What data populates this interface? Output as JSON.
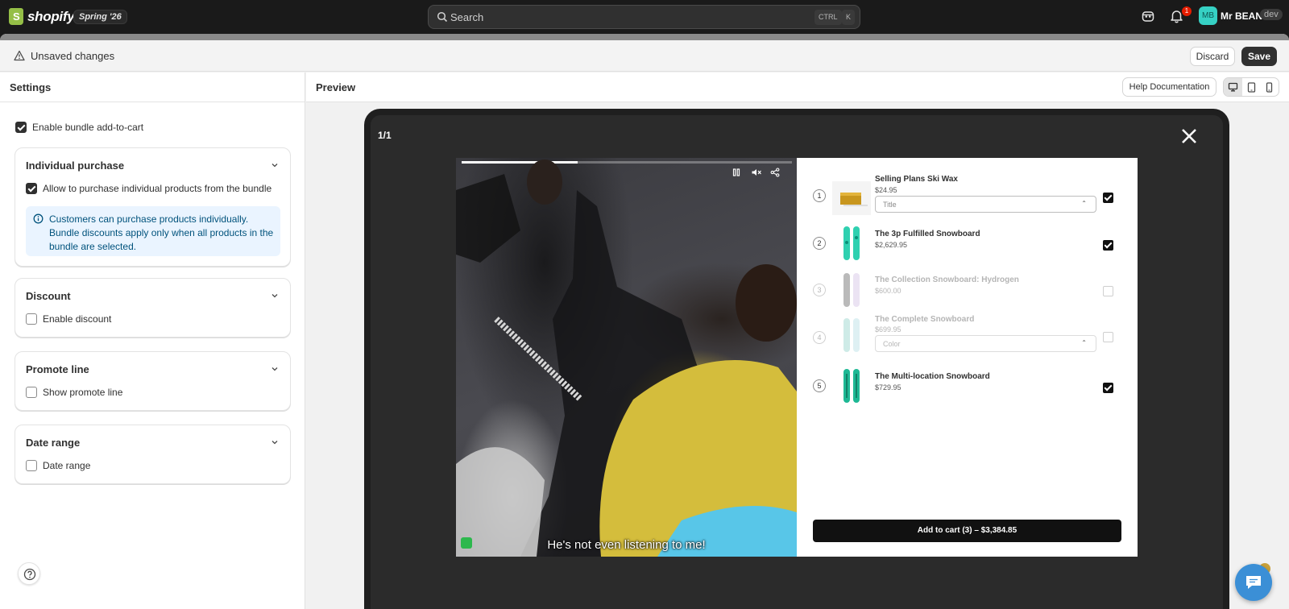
{
  "topbar": {
    "brand": "shopify",
    "brand_initial": "S",
    "season_badge": "Spring '26",
    "search_placeholder": "Search",
    "shortcut_ctrl": "CTRL",
    "shortcut_k": "K",
    "notification_count": "1",
    "user_initials": "MB",
    "user_name": "Mr BEAN",
    "store_badge": "dev"
  },
  "savebar": {
    "title": "Unsaved changes",
    "discard_label": "Discard",
    "save_label": "Save"
  },
  "settings": {
    "title": "Settings",
    "enable_bundle_label": "Enable bundle add-to-cart",
    "enable_bundle_checked": true,
    "cards": {
      "individual": {
        "title": "Individual purchase",
        "option_label": "Allow to purchase individual products from the bundle",
        "option_checked": true,
        "info_text": "Customers can purchase products individually. Bundle discounts apply only when all products in the bundle are selected."
      },
      "discount": {
        "title": "Discount",
        "option_label": "Enable discount",
        "option_checked": false
      },
      "promote": {
        "title": "Promote line",
        "option_label": "Show promote line",
        "option_checked": false
      },
      "date": {
        "title": "Date range",
        "option_label": "Date range",
        "option_checked": false
      }
    }
  },
  "preview": {
    "title": "Preview",
    "help_label": "Help Documentation",
    "counter": "1/1",
    "video": {
      "caption": "He's not even listening to me!",
      "progress": 0.35
    },
    "products": [
      {
        "num": "1",
        "name": "Selling Plans Ski Wax",
        "price": "$24.95",
        "select": "Title",
        "checked": true,
        "disabled": false
      },
      {
        "num": "2",
        "name": "The 3p Fulfilled Snowboard",
        "price": "$2,629.95",
        "select": "",
        "checked": true,
        "disabled": false
      },
      {
        "num": "3",
        "name": "The Collection Snowboard: Hydrogen",
        "price": "$600.00",
        "select": "",
        "checked": false,
        "disabled": true
      },
      {
        "num": "4",
        "name": "The Complete Snowboard",
        "price": "$699.95",
        "select": "Color",
        "checked": false,
        "disabled": true
      },
      {
        "num": "5",
        "name": "The Multi-location Snowboard",
        "price": "$729.95",
        "select": "",
        "checked": true,
        "disabled": false
      }
    ],
    "add_to_cart": "Add to cart (3) – $3,384.85"
  },
  "colors": {
    "topbar_bg": "#1a1a1a",
    "primary_button": "#303030",
    "info_bg": "#eaf4ff",
    "info_text": "#00527c",
    "avatar": "#36d1c4",
    "chat_button": "#3b8fd6"
  }
}
